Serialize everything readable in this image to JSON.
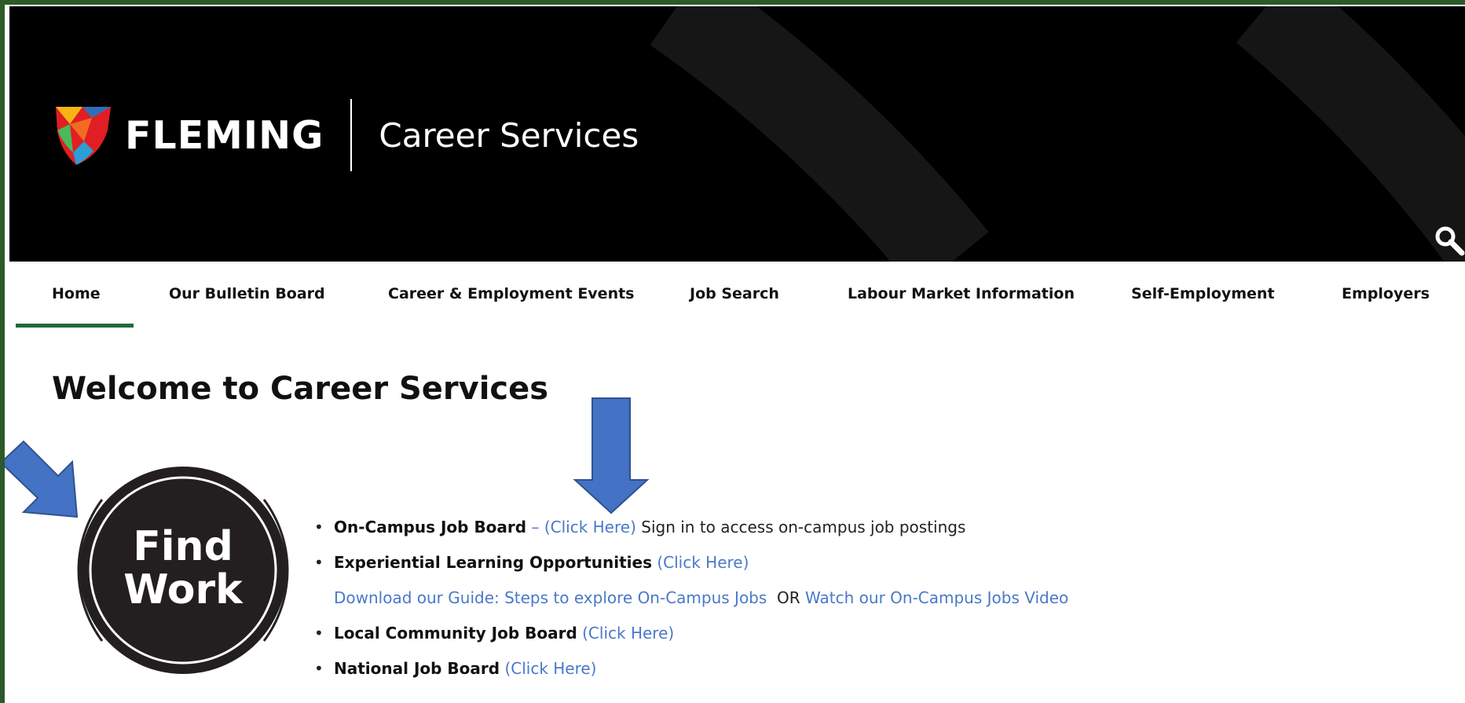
{
  "header": {
    "brand": "FLEMING",
    "site_name": "Career Services",
    "search_icon": "search-icon"
  },
  "nav": {
    "items": [
      {
        "label": "Home",
        "active": true
      },
      {
        "label": "Our Bulletin Board"
      },
      {
        "label": "Career & Employment Events"
      },
      {
        "label": "Job Search"
      },
      {
        "label": "Labour Market Information"
      },
      {
        "label": "Self-Employment"
      },
      {
        "label": "Employers"
      }
    ],
    "active_color": "#1d6b3a"
  },
  "main": {
    "title": "Welcome to Career Services",
    "badge": {
      "line1": "Find",
      "line2": "Work"
    },
    "list": {
      "item1": {
        "label": "On-Campus Job Board",
        "dash": " – ",
        "link": "(Click Here)",
        "text": " Sign in to access on-campus job postings"
      },
      "item2": {
        "label": "Experiential Learning Opportunities",
        "link": "(Click Here)"
      },
      "guide": {
        "link1": "Download our Guide: Steps to explore On-Campus Jobs",
        "or": "  OR ",
        "link2": "Watch our On-Campus Jobs Video"
      },
      "item3": {
        "label": "Local Community Job Board",
        "link": "(Click Here)"
      },
      "item4": {
        "label": "National Job Board",
        "link": "(Click Here)"
      }
    }
  },
  "colors": {
    "header_bg": "#000000",
    "link": "#4a78c9",
    "annotation_arrow": "#4472c4",
    "frame": "#2c5a2a"
  }
}
